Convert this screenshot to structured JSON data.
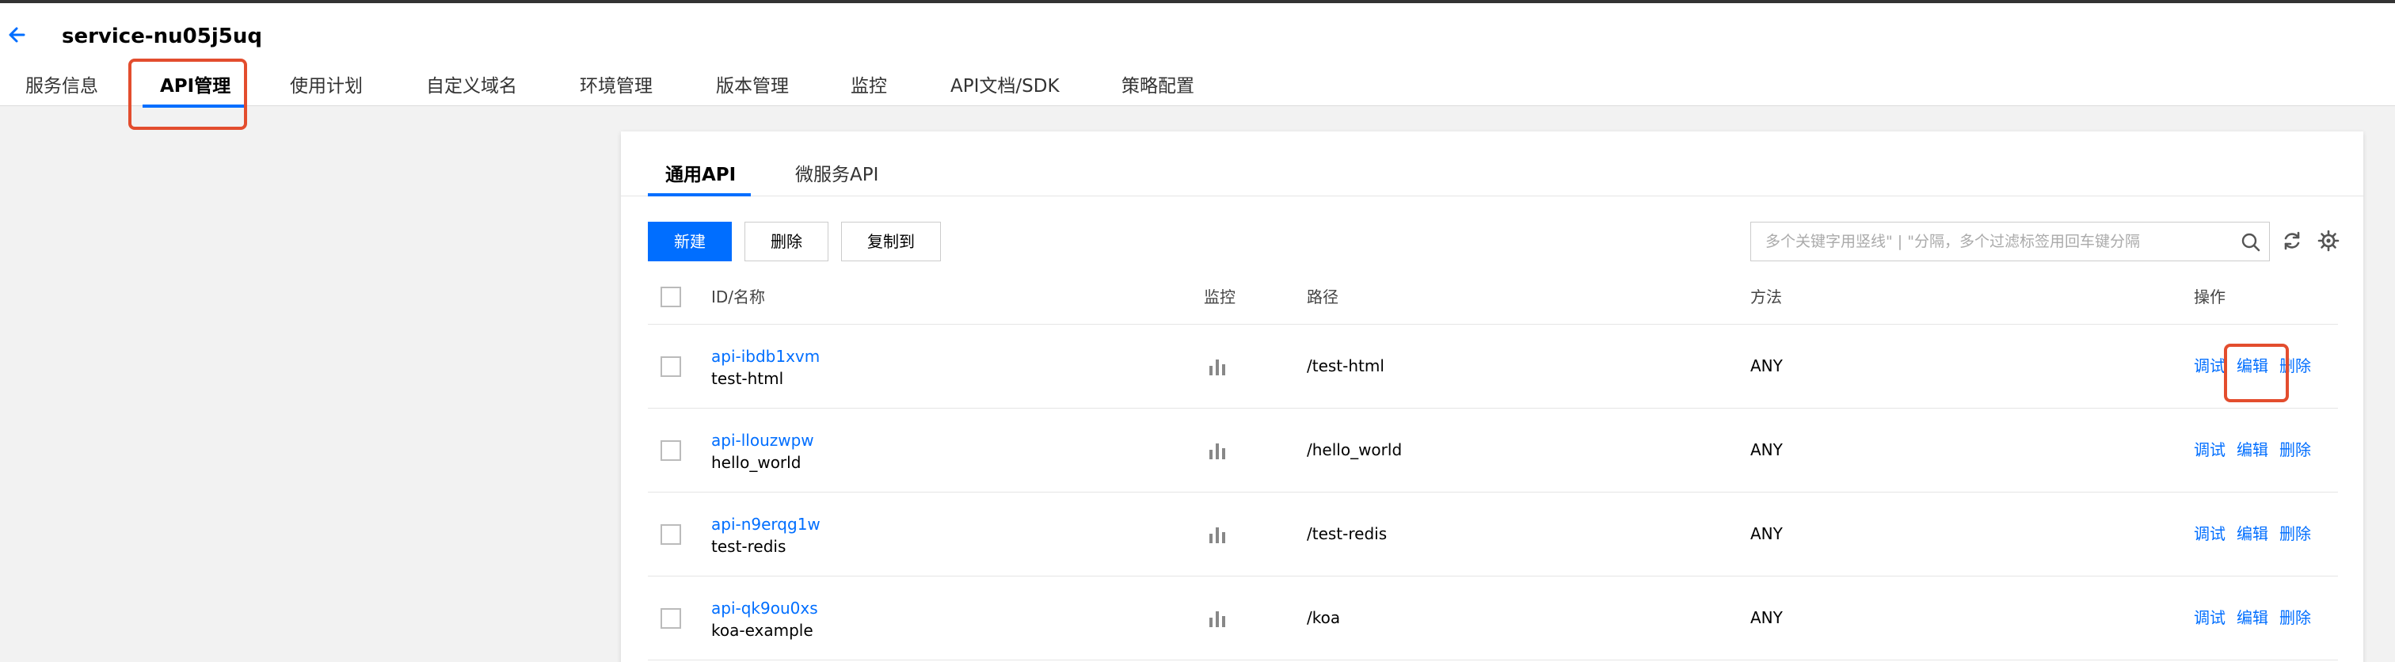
{
  "header": {
    "service_name": "service-nu05j5uq",
    "tabs": [
      {
        "label": "服务信息"
      },
      {
        "label": "API管理"
      },
      {
        "label": "使用计划"
      },
      {
        "label": "自定义域名"
      },
      {
        "label": "环境管理"
      },
      {
        "label": "版本管理"
      },
      {
        "label": "监控"
      },
      {
        "label": "API文档/SDK"
      },
      {
        "label": "策略配置"
      }
    ],
    "active_tab": "API管理"
  },
  "api_panel": {
    "tabs": [
      {
        "label": "通用API"
      },
      {
        "label": "微服务API"
      }
    ],
    "active_tab": "通用API",
    "toolbar": {
      "new_label": "新建",
      "delete_label": "删除",
      "copy_label": "复制到",
      "search_placeholder": "多个关键字用竖线\" | \"分隔，多个过滤标签用回车键分隔"
    },
    "columns": {
      "id_name": "ID/名称",
      "monitor": "监控",
      "path": "路径",
      "method": "方法",
      "actions": "操作"
    },
    "rows": [
      {
        "id": "api-ibdb1xvm",
        "name": "test-html",
        "path": "/test-html",
        "method": "ANY",
        "debug": "调试",
        "edit": "编辑",
        "delete": "删除"
      },
      {
        "id": "api-llouzwpw",
        "name": "hello_world",
        "path": "/hello_world",
        "method": "ANY",
        "debug": "调试",
        "edit": "编辑",
        "delete": "删除"
      },
      {
        "id": "api-n9erqg1w",
        "name": "test-redis",
        "path": "/test-redis",
        "method": "ANY",
        "debug": "调试",
        "edit": "编辑",
        "delete": "删除"
      },
      {
        "id": "api-qk9ou0xs",
        "name": "koa-example",
        "path": "/koa",
        "method": "ANY",
        "debug": "调试",
        "edit": "编辑",
        "delete": "删除"
      }
    ]
  },
  "colors": {
    "accent": "#006eff",
    "highlight": "#e34d2e"
  }
}
